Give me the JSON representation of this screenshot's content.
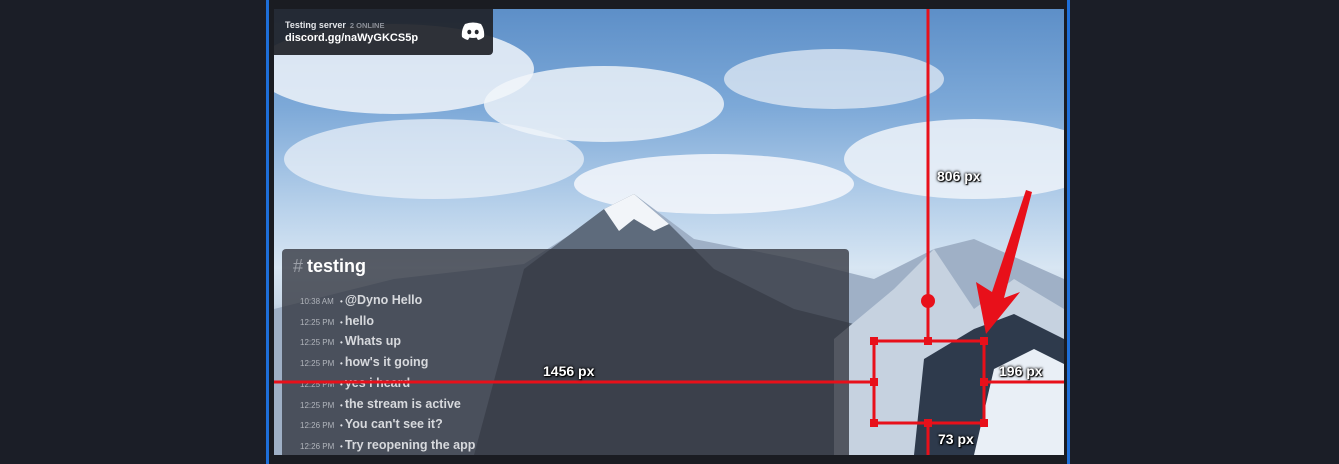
{
  "widget": {
    "server_name": "Testing server",
    "online": "2 ONLINE",
    "invite": "discord.gg/naWyGKCS5p",
    "logo_icon": "discord-logo-icon"
  },
  "chat": {
    "hash": "#",
    "channel": "testing",
    "messages": [
      {
        "time": "10:38 AM",
        "text": "@Dyno Hello"
      },
      {
        "time": "12:25 PM",
        "text": "hello"
      },
      {
        "time": "12:25 PM",
        "text": "Whats up"
      },
      {
        "time": "12:25 PM",
        "text": "how's it going"
      },
      {
        "time": "12:25 PM",
        "text": "yes i heard"
      },
      {
        "time": "12:25 PM",
        "text": "the stream is active"
      },
      {
        "time": "12:26 PM",
        "text": "You can't see it?"
      },
      {
        "time": "12:26 PM",
        "text": "Try reopening the app"
      }
    ]
  },
  "measurements": {
    "top": "806 px",
    "left": "1456 px",
    "right": "196 px",
    "bottom": "73 px"
  },
  "colors": {
    "annotation": "#e8101a",
    "frame": "#1e6fd9",
    "background": "#1b1e27"
  }
}
